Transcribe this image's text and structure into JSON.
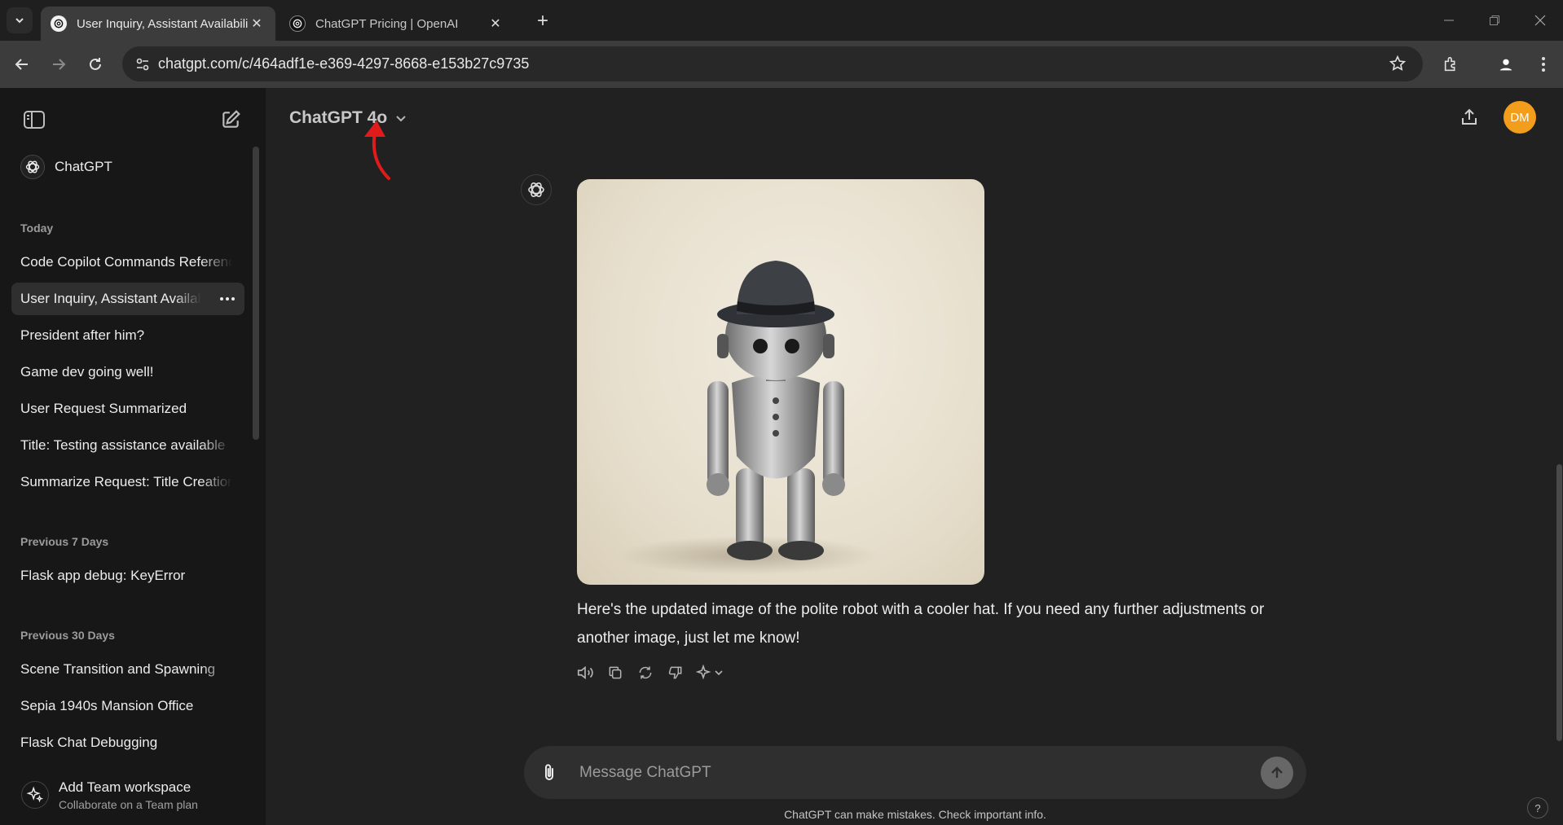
{
  "browser": {
    "tabs": [
      {
        "title": "User Inquiry, Assistant Availabili",
        "active": true
      },
      {
        "title": "ChatGPT Pricing | OpenAI",
        "active": false
      }
    ],
    "url": "chatgpt.com/c/464adf1e-e369-4297-8668-e153b27c9735",
    "icons": [
      "tab-list-icon",
      "close-icon",
      "new-tab-icon",
      "back-icon",
      "forward-icon",
      "reload-icon",
      "site-info-icon",
      "star-icon",
      "extensions-icon",
      "profile-icon",
      "kebab-menu-icon",
      "minimize-icon",
      "restore-icon"
    ]
  },
  "sidebar": {
    "gpt_label": "ChatGPT",
    "sections": [
      {
        "title": "Today",
        "items": [
          {
            "label": "Code Copilot Commands Referenc"
          },
          {
            "label": "User Inquiry, Assistant Availabi",
            "selected": true
          },
          {
            "label": "President after him?"
          },
          {
            "label": "Game dev going well!"
          },
          {
            "label": "User Request Summarized"
          },
          {
            "label": "Title: Testing assistance available"
          },
          {
            "label": "Summarize Request: Title Creation"
          }
        ]
      },
      {
        "title": "Previous 7 Days",
        "items": [
          {
            "label": "Flask app debug: KeyError"
          }
        ]
      },
      {
        "title": "Previous 30 Days",
        "items": [
          {
            "label": "Scene Transition and Spawning"
          },
          {
            "label": "Sepia 1940s Mansion Office"
          },
          {
            "label": "Flask Chat Debugging"
          }
        ]
      }
    ],
    "team": {
      "title": "Add Team workspace",
      "subtitle": "Collaborate on a Team plan"
    }
  },
  "header": {
    "model": "ChatGPT 4o",
    "avatar_initials": "DM",
    "avatar_color": "#f29d1c"
  },
  "message": {
    "text": "Here's the updated image of the polite robot with a cooler hat. If you need any further adjustments or another image, just let me know!",
    "actions": [
      "speaker-icon",
      "copy-icon",
      "regenerate-icon",
      "thumbs-down-icon",
      "sparkle-icon"
    ]
  },
  "composer": {
    "placeholder": "Message ChatGPT",
    "disclaimer": "ChatGPT can make mistakes. Check important info.",
    "help": "?"
  }
}
